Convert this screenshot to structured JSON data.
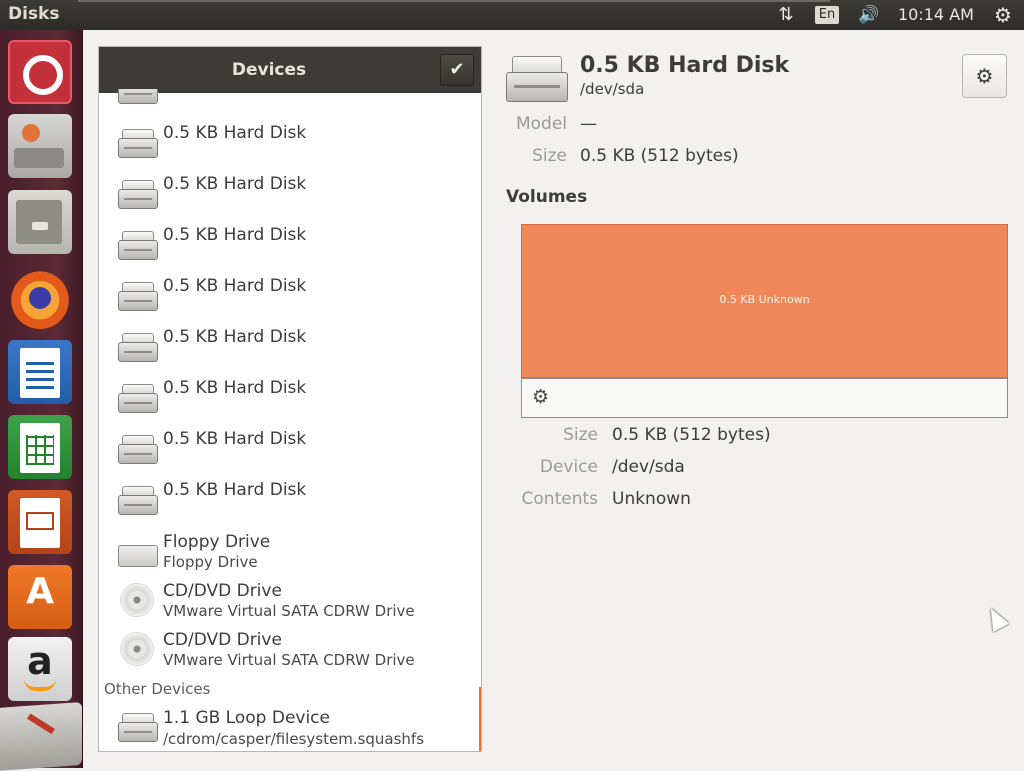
{
  "topbar": {
    "app_title": "Disks",
    "network_icon": "⇅",
    "language": "En",
    "volume_icon": "🔊",
    "clock": "10:14 AM",
    "system_icon": "⚙"
  },
  "launcher": {
    "apps": [
      {
        "name": "dash-home-icon"
      },
      {
        "name": "disks-icon"
      },
      {
        "name": "files-icon"
      },
      {
        "name": "firefox-icon"
      },
      {
        "name": "libreoffice-writer-icon"
      },
      {
        "name": "libreoffice-calc-icon"
      },
      {
        "name": "libreoffice-impress-icon"
      },
      {
        "name": "ubuntu-software-icon",
        "glyph": "A"
      },
      {
        "name": "amazon-icon",
        "glyph": "a"
      },
      {
        "name": "trash-icon"
      }
    ]
  },
  "devices": {
    "title": "Devices",
    "check_icon": "✔",
    "items": [
      {
        "title": "0.5 KB Hard Disk",
        "icon": "hard-disk-icon"
      },
      {
        "title": "0.5 KB Hard Disk",
        "icon": "hard-disk-icon"
      },
      {
        "title": "0.5 KB Hard Disk",
        "icon": "hard-disk-icon"
      },
      {
        "title": "0.5 KB Hard Disk",
        "icon": "hard-disk-icon"
      },
      {
        "title": "0.5 KB Hard Disk",
        "icon": "hard-disk-icon"
      },
      {
        "title": "0.5 KB Hard Disk",
        "icon": "hard-disk-icon"
      },
      {
        "title": "0.5 KB Hard Disk",
        "icon": "hard-disk-icon"
      },
      {
        "title": "0.5 KB Hard Disk",
        "icon": "hard-disk-icon"
      },
      {
        "title": "Floppy Drive",
        "subtitle": "Floppy Drive",
        "icon": "floppy-drive-icon"
      },
      {
        "title": "CD/DVD Drive",
        "subtitle": "VMware Virtual SATA CDRW Drive",
        "icon": "optical-drive-icon"
      },
      {
        "title": "CD/DVD Drive",
        "subtitle": "VMware Virtual SATA CDRW Drive",
        "icon": "optical-drive-icon"
      }
    ],
    "other_label": "Other Devices",
    "other_items": [
      {
        "title": "1.1 GB Loop Device",
        "subtitle": "/cdrom/casper/filesystem.squashfs",
        "icon": "hard-disk-icon"
      }
    ]
  },
  "disk": {
    "name": "0.5 KB Hard Disk",
    "path": "/dev/sda",
    "settings_icon": "⚙",
    "model_label": "Model",
    "model_value": "—",
    "size_label": "Size",
    "size_value": "0.5 KB (512 bytes)"
  },
  "volumes": {
    "heading": "Volumes",
    "block_label": "0.5 KB Unknown",
    "block_color": "#f0875a",
    "tool_icon": "⚙",
    "size_label": "Size",
    "size_value": "0.5 KB (512 bytes)",
    "device_label": "Device",
    "device_value": "/dev/sda",
    "contents_label": "Contents",
    "contents_value": "Unknown"
  }
}
